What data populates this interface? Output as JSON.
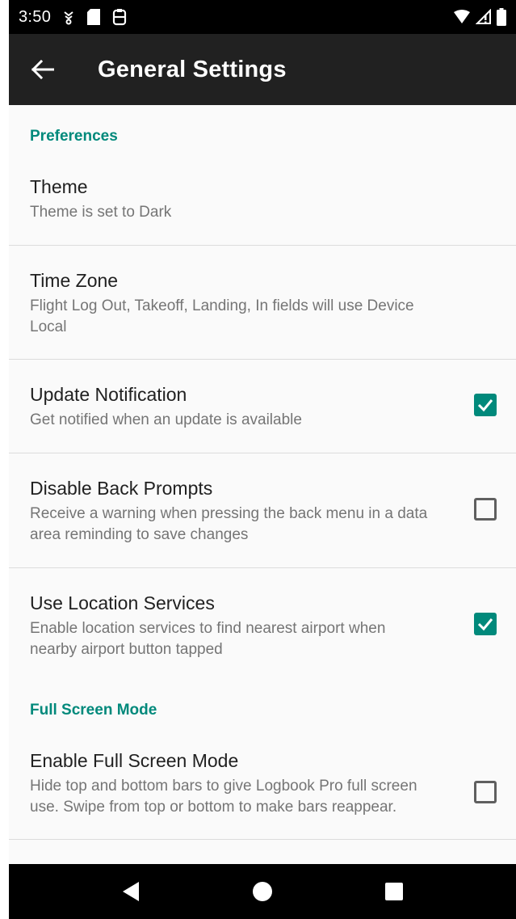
{
  "status_bar": {
    "time": "3:50",
    "left_icons": [
      "wifi-assist-icon",
      "sd-card-icon",
      "clipboard-icon"
    ],
    "right_icons": [
      "wifi-icon",
      "signal-icon",
      "battery-icon"
    ]
  },
  "app_bar": {
    "back_icon": "arrow-back-icon",
    "title": "General Settings",
    "background": "#212121"
  },
  "accent_color": "#00897b",
  "sections": [
    {
      "header": "Preferences",
      "items": [
        {
          "title": "Theme",
          "summary": "Theme is set to Dark"
        },
        {
          "title": "Time Zone",
          "summary": "Flight Log Out, Takeoff, Landing, In fields will use Device Local"
        },
        {
          "title": "Update Notification",
          "summary": "Get notified when an update is available",
          "checked": true
        },
        {
          "title": "Disable Back Prompts",
          "summary": "Receive a warning when pressing the back menu in a data area reminding to save changes",
          "checked": false
        },
        {
          "title": "Use Location Services",
          "summary": "Enable location services to find nearest airport when nearby airport button tapped",
          "checked": true
        }
      ]
    },
    {
      "header": "Full Screen Mode",
      "items": [
        {
          "title": "Enable Full Screen Mode",
          "summary": "Hide top and bottom bars to give Logbook Pro full screen use. Swipe from top or bottom to make bars reappear.",
          "checked": false
        }
      ]
    }
  ],
  "nav_bar": {
    "buttons": [
      "back-triangle-icon",
      "home-circle-icon",
      "recents-square-icon"
    ]
  }
}
